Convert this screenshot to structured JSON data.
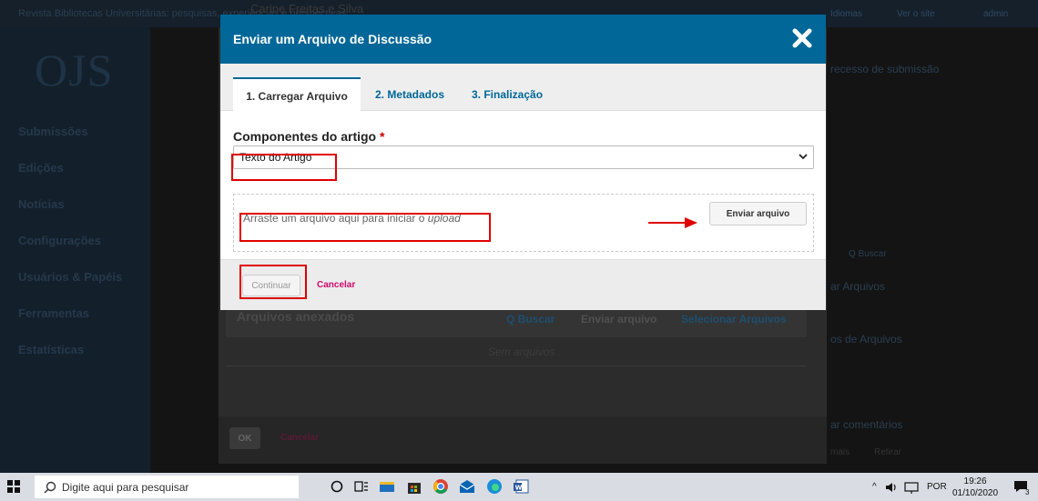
{
  "background": {
    "breadcrumb": "Revista Bibliotecas Universitárias: pesquisas, experiências e perspectivas",
    "context_name": "Carine Freitas e Silva",
    "logo": "OJS",
    "nav": [
      "Submissões",
      "Edições",
      "Notícias",
      "Configurações",
      "Usuários & Papéis",
      "Ferramentas",
      "Estatísticas"
    ],
    "top_right": [
      "Idiomas",
      "Ver o site",
      "admin"
    ],
    "right_fragments": [
      "recesso de submissão",
      "Q  Buscar",
      "ar Arquivos",
      "os de Arquivos",
      "ar comentários",
      "s",
      "mais",
      "Retirar"
    ],
    "files_panel": {
      "title": "Arquivos anexados",
      "search": "Q  Buscar",
      "upload": "Enviar arquivo",
      "select": "Selecionar Arquivos",
      "empty": "Sem arquivos"
    },
    "footer": {
      "ok": "OK",
      "cancel": "Cancelar"
    }
  },
  "modal": {
    "title": "Enviar um Arquivo de Discussão",
    "tabs": [
      "1. Carregar Arquivo",
      "2. Metadados",
      "3. Finalização"
    ],
    "active_tab": 0,
    "field_label": "Componentes do artigo",
    "required_mark": "*",
    "select_value": "Texto do Artigo",
    "dropzone_text": "Arraste um arquivo aqui para iniciar o",
    "dropzone_emph": "upload",
    "upload_button": "Enviar arquivo",
    "continue_button": "Continuar",
    "cancel_link": "Cancelar"
  },
  "taskbar": {
    "search_placeholder": "Digite aqui para pesquisar",
    "language": "POR",
    "time": "19:26",
    "date": "01/10/2020",
    "notifications": "3"
  },
  "colors": {
    "header_blue": "#006798",
    "link_pink": "#d00a6c",
    "annotation_red": "#e00000"
  }
}
